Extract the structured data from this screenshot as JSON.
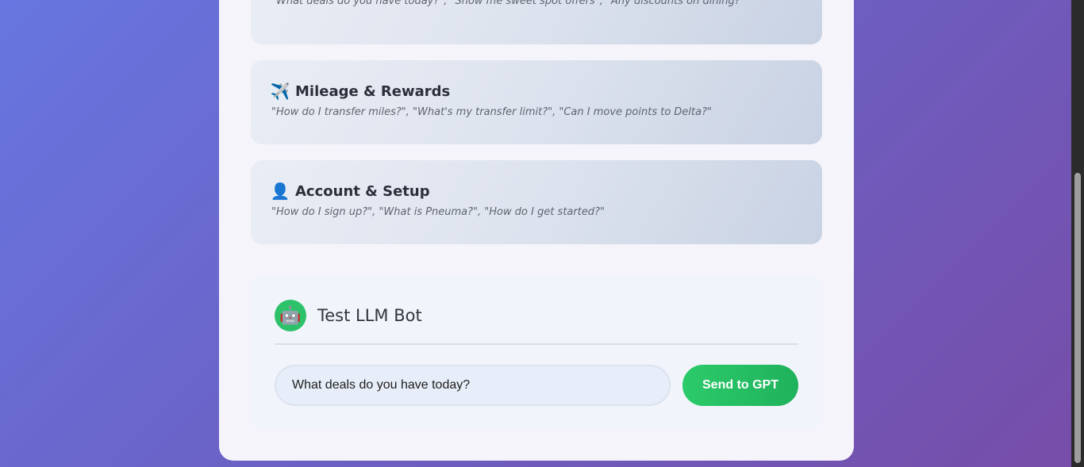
{
  "categories": [
    {
      "icon": "",
      "icon_name": "none",
      "title": "",
      "examples": "\"What deals do you have today?\", \"Show me sweet spot offers\", \"Any discounts on dining?\""
    },
    {
      "icon": "✈️",
      "icon_name": "airplane-icon",
      "title": "Mileage & Rewards",
      "examples": "\"How do I transfer miles?\", \"What's my transfer limit?\", \"Can I move points to Delta?\""
    },
    {
      "icon": "👤",
      "icon_name": "person-icon",
      "title": "Account & Setup",
      "examples": "\"How do I sign up?\", \"What is Pneuma?\", \"How do I get started?\""
    }
  ],
  "bot": {
    "avatar_icon": "🤖",
    "avatar_icon_name": "robot-icon",
    "title": "Test LLM Bot",
    "input_value": "What deals do you have today?",
    "send_label": "Send to GPT"
  },
  "colors": {
    "accent_green": "#22c55e",
    "background_start": "#6776e0",
    "background_end": "#764da8"
  }
}
